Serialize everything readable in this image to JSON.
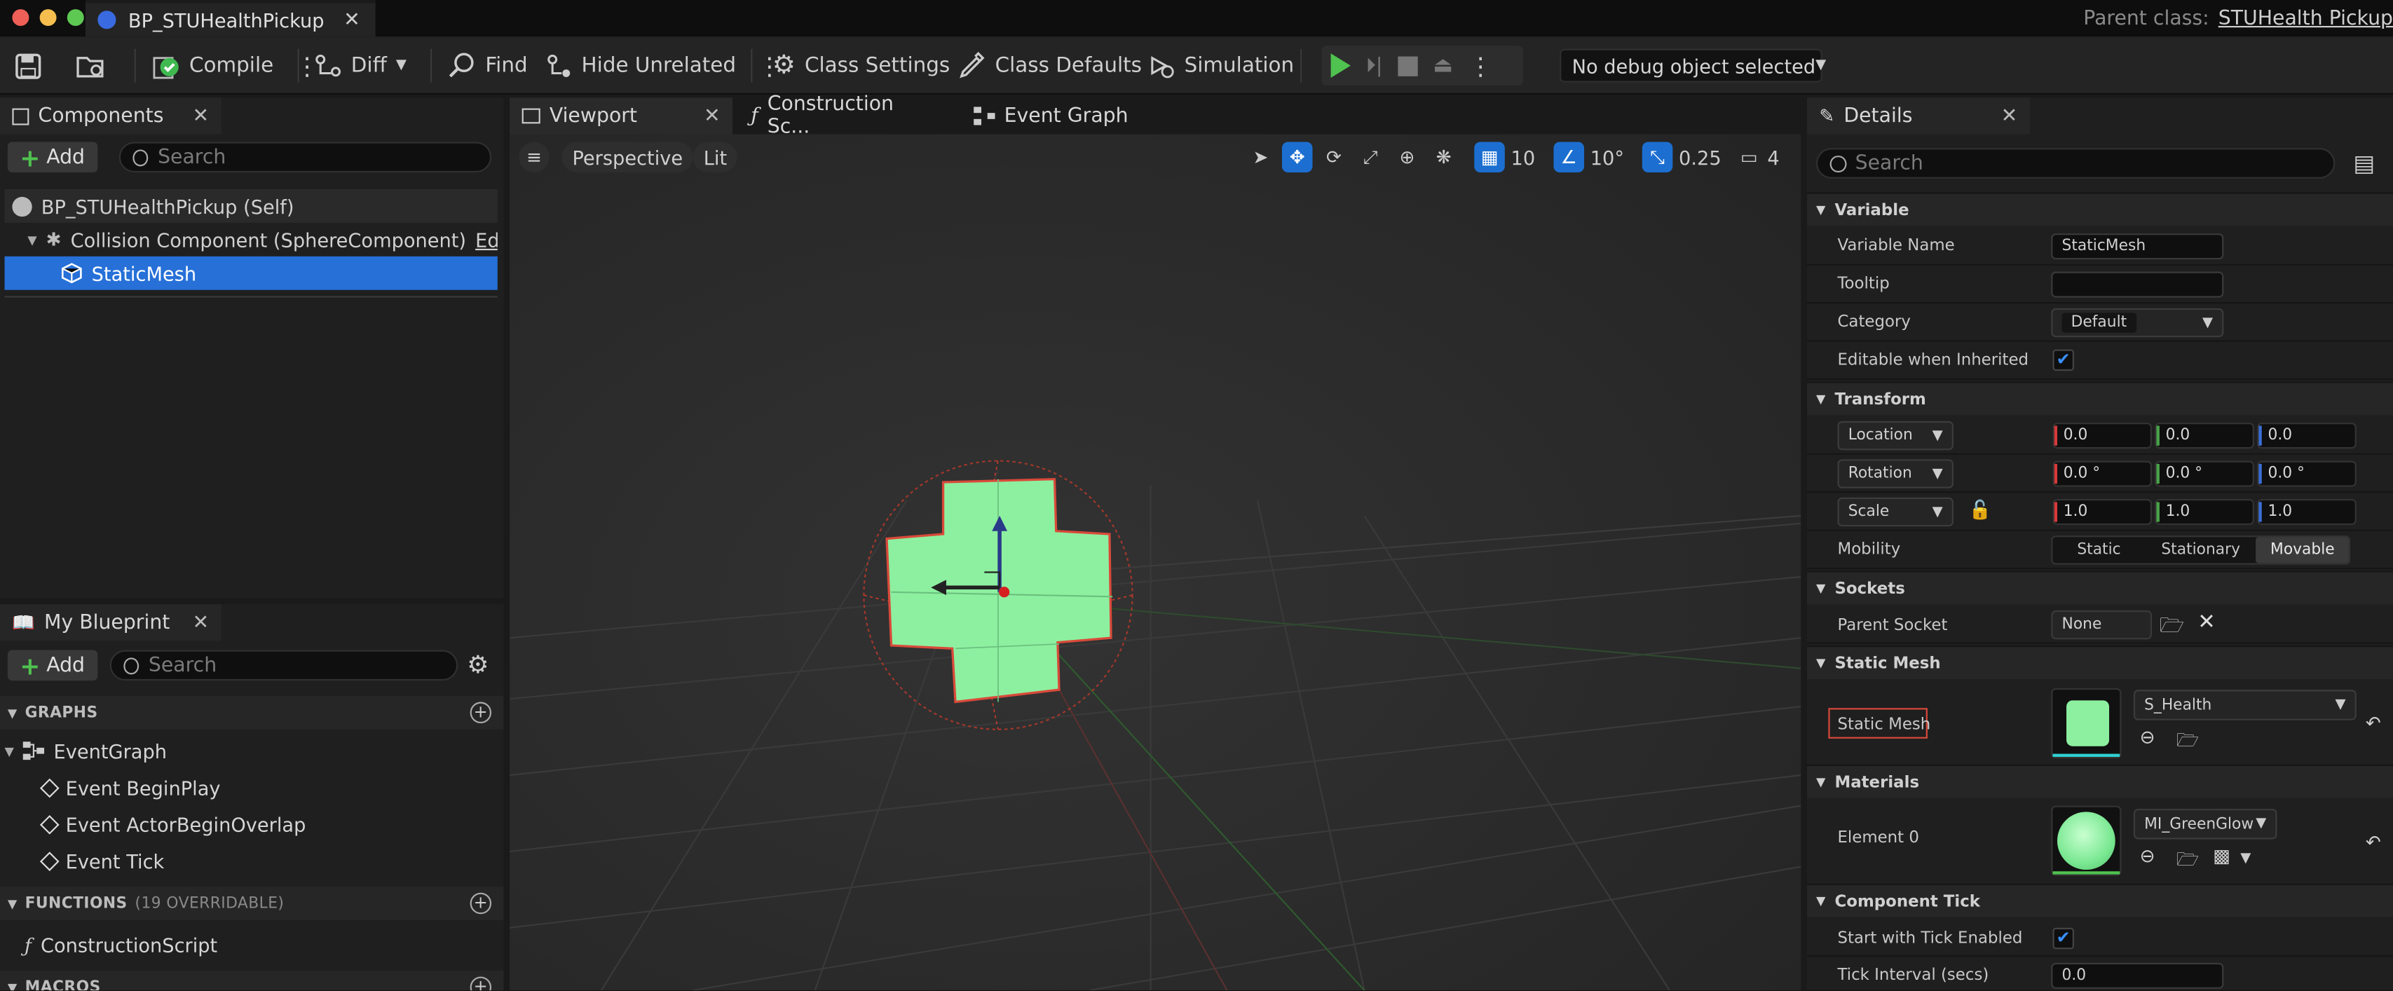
{
  "window": {
    "tab_title": "BP_STUHealthPickup",
    "parent_class_label": "Parent class:",
    "parent_class_value": "STUHealth Pickup"
  },
  "toolbar": {
    "compile": "Compile",
    "diff": "Diff",
    "find": "Find",
    "hide_unrelated": "Hide Unrelated",
    "class_settings": "Class Settings",
    "class_defaults": "Class Defaults",
    "simulation": "Simulation",
    "debug_object": "No debug object selected"
  },
  "components": {
    "tab_label": "Components",
    "add_label": "Add",
    "search_placeholder": "Search",
    "items": [
      {
        "label": "BP_STUHealthPickup (Self)"
      },
      {
        "label": "Collision Component (SphereComponent)",
        "extra": "Edit in C++"
      },
      {
        "label": "StaticMesh"
      }
    ]
  },
  "my_blueprint": {
    "tab_label": "My Blueprint",
    "add_label": "Add",
    "search_placeholder": "Search",
    "graphs_header": "GRAPHS",
    "event_graph": "EventGraph",
    "events": [
      "Event BeginPlay",
      "Event ActorBeginOverlap",
      "Event Tick"
    ],
    "functions_header": "FUNCTIONS",
    "functions_note": "(19 OVERRIDABLE)",
    "construction_script": "ConstructionScript",
    "macros_header": "MACROS"
  },
  "editor_tabs": {
    "viewport": "Viewport",
    "construction": "Construction Sc...",
    "event_graph": "Event Graph"
  },
  "viewport": {
    "perspective": "Perspective",
    "lit": "Lit",
    "grid_snap": "10",
    "rot_snap": "10°",
    "scale_snap": "0.25",
    "camera_speed": "4"
  },
  "details": {
    "tab_label": "Details",
    "search_placeholder": "Search",
    "variable": {
      "header": "Variable",
      "name_label": "Variable Name",
      "name_value": "StaticMesh",
      "tooltip_label": "Tooltip",
      "tooltip_value": "",
      "category_label": "Category",
      "category_value": "Default",
      "editable_label": "Editable when Inherited"
    },
    "transform": {
      "header": "Transform",
      "location_label": "Location",
      "location": [
        "0.0",
        "0.0",
        "0.0"
      ],
      "rotation_label": "Rotation",
      "rotation": [
        "0.0 °",
        "0.0 °",
        "0.0 °"
      ],
      "scale_label": "Scale",
      "scale": [
        "1.0",
        "1.0",
        "1.0"
      ],
      "mobility_label": "Mobility",
      "mobility_options": [
        "Static",
        "Stationary",
        "Movable"
      ]
    },
    "sockets": {
      "header": "Sockets",
      "parent_label": "Parent Socket",
      "parent_value": "None"
    },
    "static_mesh": {
      "header": "Static Mesh",
      "label": "Static Mesh",
      "value": "S_Health"
    },
    "materials": {
      "header": "Materials",
      "element_label": "Element 0",
      "value": "MI_GreenGlow"
    },
    "component_tick": {
      "header": "Component Tick",
      "start_label": "Start with Tick Enabled",
      "interval_label": "Tick Interval (secs)",
      "interval_value": "0.0"
    }
  },
  "colors": {
    "accent_blue": "#1c6fd1",
    "selected_row": "#2670d8",
    "highlight_red": "#d94a3a",
    "mesh_green": "#8df0a0"
  }
}
